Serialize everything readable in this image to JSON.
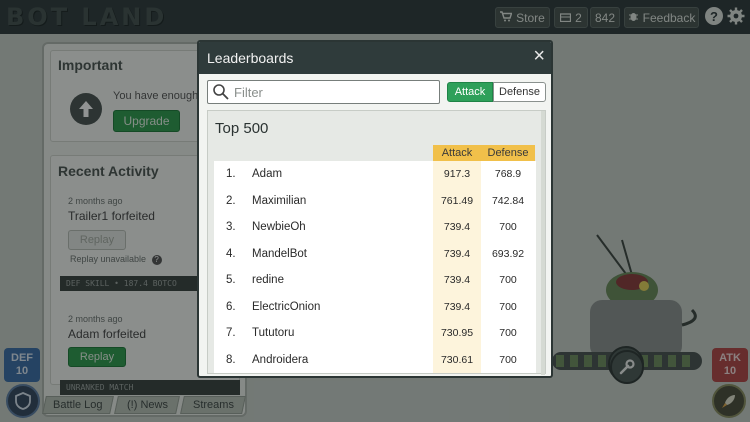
{
  "topbar": {
    "logo": "BOT LAND",
    "store_label": "Store",
    "crates_count": "2",
    "currency": "842",
    "feedback_label": "Feedback",
    "help_glyph": "?"
  },
  "important": {
    "title": "Important",
    "message": "You have enough",
    "upgrade_label": "Upgrade"
  },
  "recent": {
    "title": "Recent Activity",
    "items": [
      {
        "time": "2 months ago",
        "name": "Trailer1",
        "status": "forfeited",
        "replay_label": "Replay",
        "note": "Replay unavailable",
        "strip": "DEF SKILL • 187.4     BOTCO"
      },
      {
        "time": "2 months ago",
        "name": "Adam",
        "status": "forfeited",
        "replay_label": "Replay",
        "strip": "UNRANKED MATCH"
      }
    ]
  },
  "bottom_tabs": [
    "Battle Log",
    "(!) News",
    "Streams"
  ],
  "def_badge": {
    "label": "DEF",
    "value": "10"
  },
  "atk_badge": {
    "label": "ATK",
    "value": "10"
  },
  "leaderboard": {
    "title": "Leaderboards",
    "filter_placeholder": "Filter",
    "tabs": [
      "Attack",
      "Defense"
    ],
    "active_tab": "Attack",
    "heading": "Top 500",
    "columns": [
      "Attack",
      "Defense"
    ],
    "rows": [
      {
        "rank": "1.",
        "name": "Adam",
        "attack": "917.3",
        "defense": "768.9"
      },
      {
        "rank": "2.",
        "name": "Maximilian",
        "attack": "761.49",
        "defense": "742.84"
      },
      {
        "rank": "3.",
        "name": "NewbieOh",
        "attack": "739.4",
        "defense": "700"
      },
      {
        "rank": "4.",
        "name": "MandelBot",
        "attack": "739.4",
        "defense": "693.92"
      },
      {
        "rank": "5.",
        "name": "redine",
        "attack": "739.4",
        "defense": "700"
      },
      {
        "rank": "6.",
        "name": "ElectricOnion",
        "attack": "739.4",
        "defense": "700"
      },
      {
        "rank": "7.",
        "name": "Tututoru",
        "attack": "730.95",
        "defense": "700"
      },
      {
        "rank": "8.",
        "name": "Androidera",
        "attack": "730.61",
        "defense": "700"
      }
    ]
  },
  "colors": {
    "accent_green": "#2ea05a",
    "header_gold": "#f1c04a",
    "def_blue": "#3b6ea8",
    "atk_red": "#b24646"
  }
}
